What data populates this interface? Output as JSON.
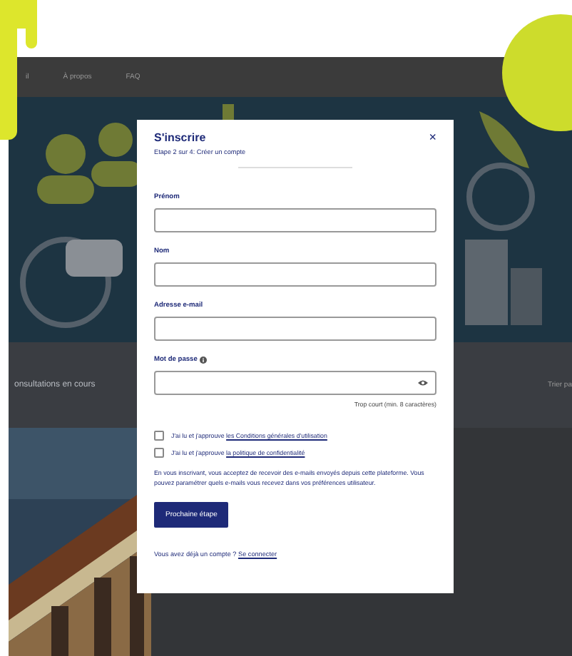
{
  "nav": {
    "items": [
      {
        "label": "il"
      },
      {
        "label": "À propos"
      },
      {
        "label": "FAQ"
      }
    ]
  },
  "section": {
    "heading": "onsultations en cours",
    "sort_label": "Trier pa"
  },
  "modal": {
    "title": "S'inscrire",
    "close": "×",
    "step": "Etape 2 sur 4: Créer un compte",
    "fields": [
      {
        "label": "Prénom",
        "kind": "text",
        "info": false
      },
      {
        "label": "Nom",
        "kind": "text",
        "info": false
      },
      {
        "label": "Adresse e-mail",
        "kind": "text",
        "info": false
      },
      {
        "label": "Mot de passe",
        "kind": "password",
        "info": true,
        "hint": "Trop court (min. 8 caractères)"
      }
    ],
    "agreements": [
      {
        "text": "J'ai lu et j'approuve",
        "link": "les Conditions générales d'utilisation",
        "checked": false
      },
      {
        "text": "J'ai lu et j'approuve",
        "link": "la politique de confidentialité",
        "checked": false
      }
    ],
    "notice": "En vous inscrivant, vous acceptez de recevoir des e-mails envoyés depuis cette plateforme. Vous pouvez paramétrer quels e-mails vous recevez dans vos préférences utilisateur.",
    "submit": "Prochaine étape",
    "footer": {
      "text": "Vous avez déjà un compte ?",
      "link": "Se connecter"
    }
  }
}
